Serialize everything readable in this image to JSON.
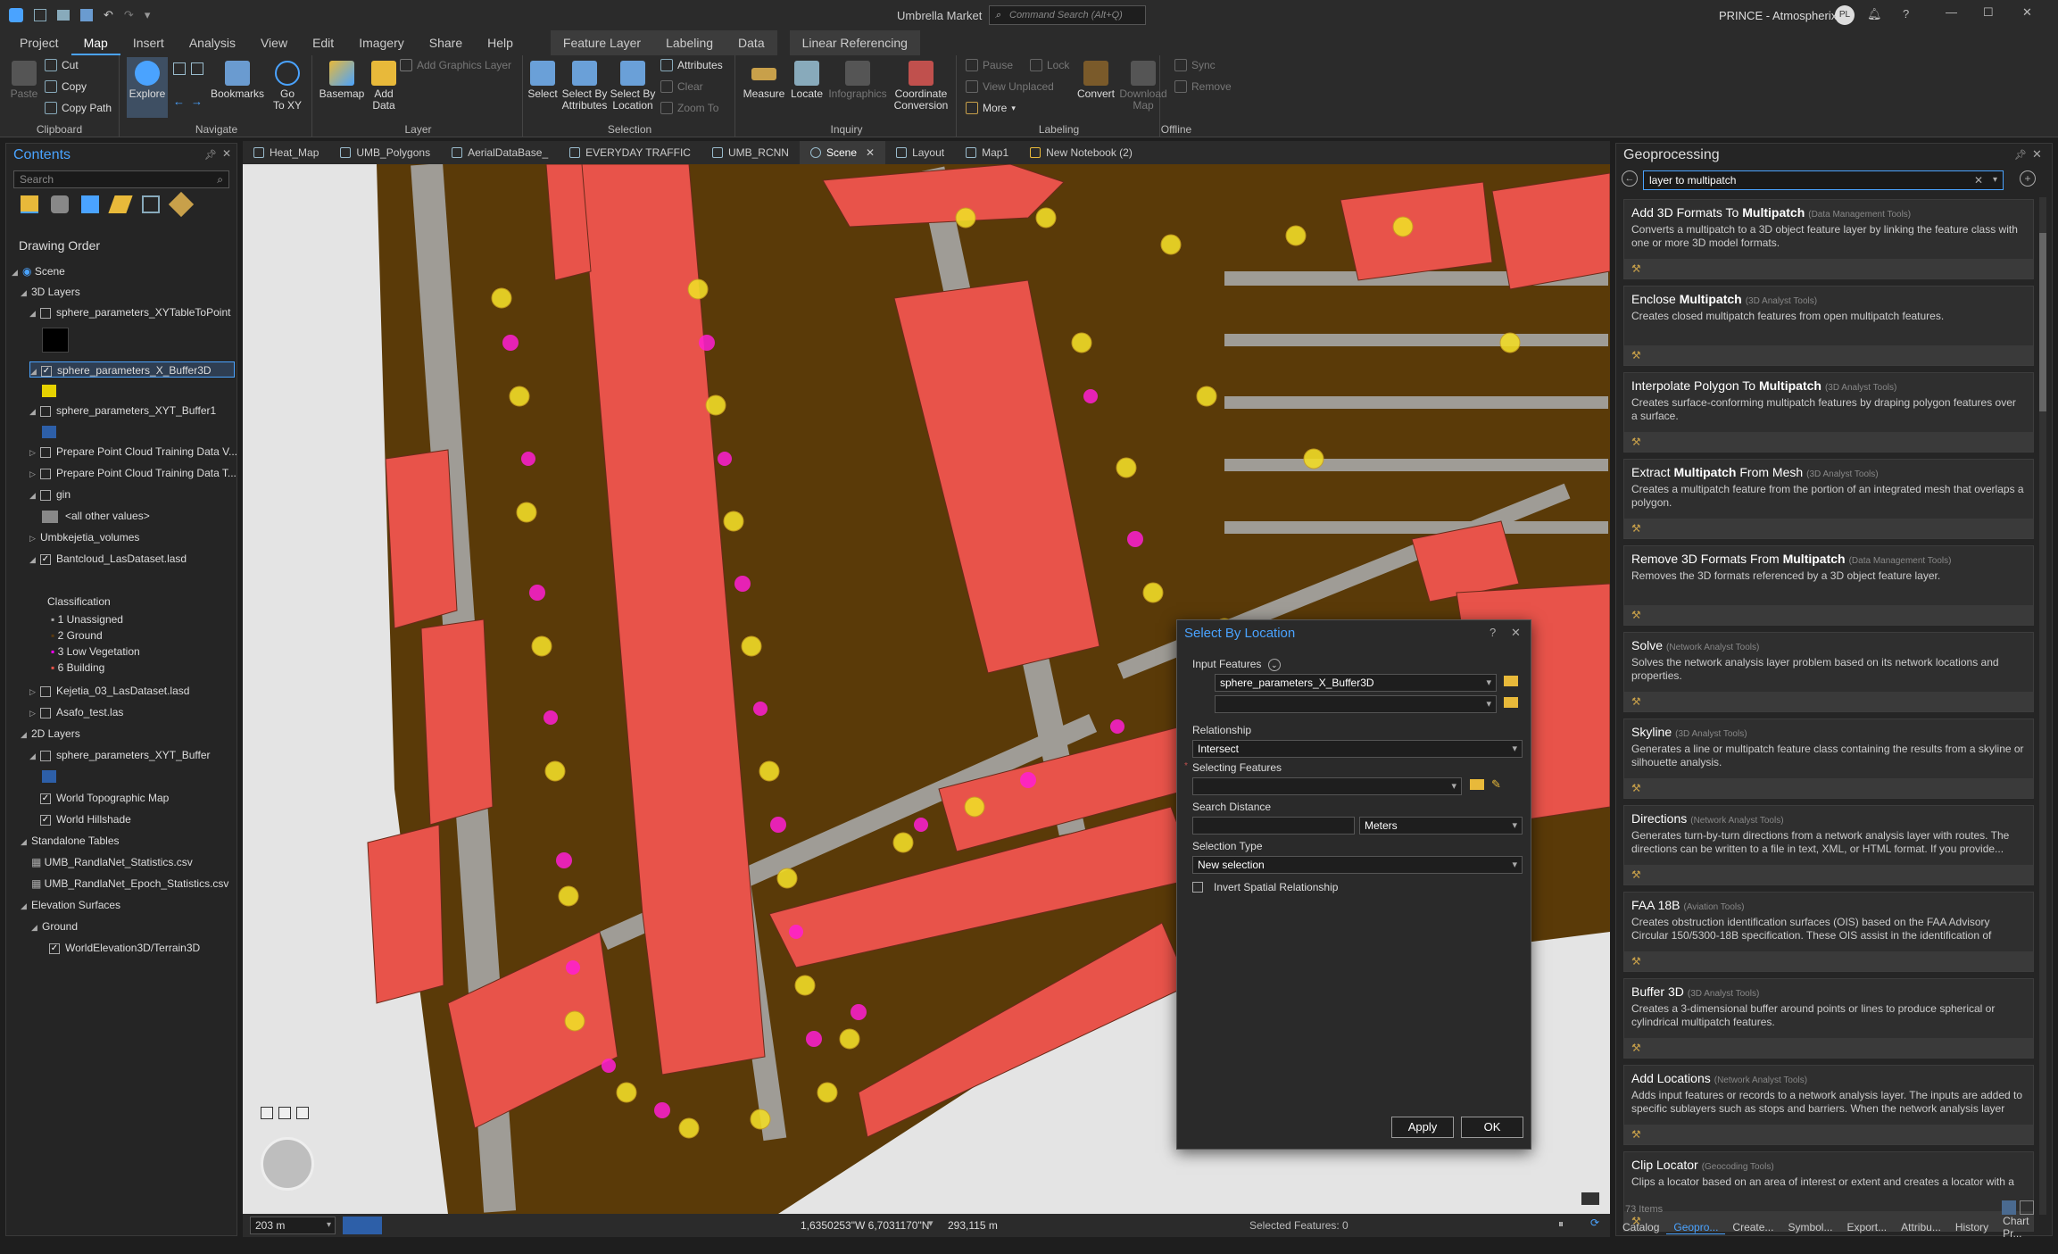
{
  "title": {
    "app_title": "Umbrella Market",
    "command_search_placeholder": "Command Search (Alt+Q)",
    "user": "PRINCE - Atmospherix",
    "avatar_initials": "PL"
  },
  "ribbon_tabs": [
    "Project",
    "Map",
    "Insert",
    "Analysis",
    "View",
    "Edit",
    "Imagery",
    "Share",
    "Help",
    "Feature Layer",
    "Labeling",
    "Data",
    "Linear Referencing"
  ],
  "ribbon": {
    "clipboard": {
      "label": "Clipboard",
      "paste": "Paste",
      "cut": "Cut",
      "copy": "Copy",
      "copy_path": "Copy Path"
    },
    "navigate": {
      "label": "Navigate",
      "explore": "Explore",
      "bookmarks": "Bookmarks",
      "go_to_xy": "Go\nTo XY"
    },
    "layer": {
      "label": "Layer",
      "basemap": "Basemap",
      "add_data": "Add\nData",
      "add_graphics_layer": "Add Graphics Layer"
    },
    "selection": {
      "label": "Selection",
      "select": "Select",
      "select_by_attributes": "Select By\nAttributes",
      "select_by_location": "Select By\nLocation",
      "attributes": "Attributes",
      "clear": "Clear",
      "zoom_to": "Zoom To"
    },
    "inquiry": {
      "label": "Inquiry",
      "measure": "Measure",
      "locate": "Locate",
      "infographics": "Infographics",
      "coordinate_conversion": "Coordinate\nConversion"
    },
    "labeling": {
      "label": "Labeling",
      "pause": "Pause",
      "lock": "Lock",
      "view_unplaced": "View Unplaced",
      "more": "More",
      "convert": "Convert"
    },
    "offline": {
      "label": "Offline",
      "download_map": "Download\nMap",
      "sync": "Sync",
      "remove": "Remove"
    }
  },
  "contents": {
    "title": "Contents",
    "search_placeholder": "Search",
    "drawing_order": "Drawing Order",
    "items": {
      "scene": "Scene",
      "layers3d": "3D Layers",
      "xytable": "sphere_parameters_XYTableToPoint",
      "xbuffer3d": "sphere_parameters_X_Buffer3D",
      "xytbuffer1": "sphere_parameters_XYT_Buffer1",
      "prep1": "Prepare Point Cloud Training Data V...",
      "prep2": "Prepare Point Cloud Training Data T...",
      "gin": "gin",
      "allother": "<all other values>",
      "umbvol": "Umbkejetia_volumes",
      "bantcloud": "Bantcloud_LasDataset.lasd",
      "classification": "Classification",
      "c1": "1  Unassigned",
      "c2": "2  Ground",
      "c3": "3  Low Vegetation",
      "c6": "6  Building",
      "kejetia": "Kejetia_03_LasDataset.lasd",
      "asafo": "Asafo_test.las",
      "layers2d": "2D Layers",
      "xytbuffer": "sphere_parameters_XYT_Buffer",
      "topo": "World Topographic Map",
      "hillshade": "World Hillshade",
      "standalone": "Standalone Tables",
      "stats1": "UMB_RandlaNet_Statistics.csv",
      "stats2": "UMB_RandlaNet_Epoch_Statistics.csv",
      "elevation": "Elevation Surfaces",
      "ground": "Ground",
      "terrain": "WorldElevation3D/Terrain3D"
    }
  },
  "doc_tabs": [
    "Heat_Map",
    "UMB_Polygons",
    "AerialDataBase_",
    "EVERYDAY TRAFFIC",
    "UMB_RCNN",
    "Scene",
    "Layout",
    "Map1",
    "New Notebook (2)"
  ],
  "status": {
    "scale": "203 m",
    "coords": "1,6350253\"W 6,7031170\"N",
    "elevation": "293,115 m",
    "selected": "Selected Features: 0"
  },
  "geoprocessing": {
    "title": "Geoprocessing",
    "search_value": "layer to multipatch",
    "items_count": "73 Items",
    "results": [
      {
        "pre": "Add 3D Formats To ",
        "bold": "Multipatch",
        "post": "",
        "src": "(Data Management Tools)",
        "desc": "Converts a multipatch to a 3D object feature layer by linking the feature class with one or more 3D model formats."
      },
      {
        "pre": "Enclose ",
        "bold": "Multipatch",
        "post": "",
        "src": "(3D Analyst Tools)",
        "desc": "Creates  closed multipatch features from open multipatch features."
      },
      {
        "pre": "Interpolate Polygon To ",
        "bold": "Multipatch",
        "post": "",
        "src": "(3D Analyst Tools)",
        "desc": "Creates surface-conforming  multipatch features by draping polygon features over a surface."
      },
      {
        "pre": "Extract ",
        "bold": "Multipatch",
        "post": " From Mesh",
        "src": "(3D Analyst Tools)",
        "desc": "Creates a multipatch feature from the portion of an integrated mesh that overlaps a polygon."
      },
      {
        "pre": "Remove 3D Formats From ",
        "bold": "Multipatch",
        "post": "",
        "src": "(Data Management Tools)",
        "desc": "Removes the 3D formats  referenced by a 3D object feature layer."
      },
      {
        "pre": "Solve",
        "bold": "",
        "post": "",
        "src": "(Network Analyst Tools)",
        "desc": "Solves the network analysis layer problem based on its network locations and properties."
      },
      {
        "pre": "Skyline",
        "bold": "",
        "post": "",
        "src": "(3D Analyst Tools)",
        "desc": "Generates a line or multipatch feature class containing the results from a skyline or silhouette analysis."
      },
      {
        "pre": "Directions",
        "bold": "",
        "post": "",
        "src": "(Network Analyst Tools)",
        "desc": "Generates turn-by-turn directions from a network analysis layer with routes. The directions can be written to a file in text, XML, or HTML format. If you provide..."
      },
      {
        "pre": "FAA 18B",
        "bold": "",
        "post": "",
        "src": "(Aviation Tools)",
        "desc": "Creates obstruction identification surfaces (OIS) based on the FAA Advisory Circular 150/5300-18B specification. These OIS assist in the identification of possi..."
      },
      {
        "pre": "Buffer 3D",
        "bold": "",
        "post": "",
        "src": "(3D Analyst Tools)",
        "desc": "Creates a 3-dimensional buffer around points or lines to produce spherical or cylindrical multipatch features."
      },
      {
        "pre": "Add Locations",
        "bold": "",
        "post": "",
        "src": "(Network Analyst Tools)",
        "desc": "Adds input features or records to a network analysis layer. The inputs are added to specific sublayers such as stops and barriers. When the network analysis layer re..."
      },
      {
        "pre": "Clip Locator",
        "bold": "",
        "post": "",
        "src": "(Geocoding Tools)",
        "desc": "Clips a locator based on an area of interest or extent  and creates a locator with a"
      }
    ],
    "bottom_tabs": [
      "Catalog",
      "Geopro...",
      "Create...",
      "Symbol...",
      "Export...",
      "Attribu...",
      "History",
      "Chart Pr..."
    ]
  },
  "dialog": {
    "title": "Select By Location",
    "input_features_label": "Input Features",
    "input_features_value": "sphere_parameters_X_Buffer3D",
    "relationship_label": "Relationship",
    "relationship_value": "Intersect",
    "selecting_features_label": "Selecting Features",
    "search_distance_label": "Search Distance",
    "distance_unit": "Meters",
    "selection_type_label": "Selection Type",
    "selection_type_value": "New selection",
    "invert_label": "Invert Spatial Relationship",
    "apply": "Apply",
    "ok": "OK"
  }
}
